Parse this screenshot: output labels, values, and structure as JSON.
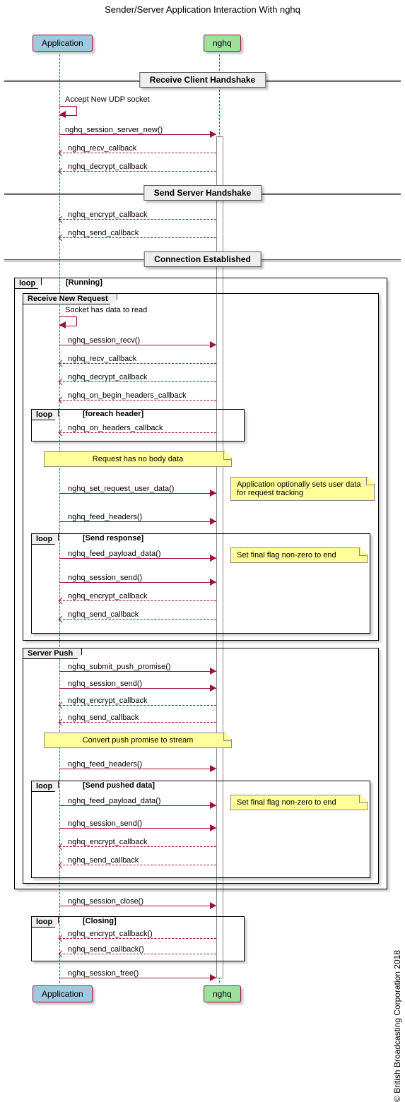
{
  "title": "Sender/Server Application Interaction With nghq",
  "actors": {
    "app": "Application",
    "nghq": "nghq"
  },
  "dividers": {
    "recv_handshake": "Receive Client Handshake",
    "send_handshake": "Send Server Handshake",
    "conn_est": "Connection Established"
  },
  "frames": {
    "running": {
      "tag": "loop",
      "cond": "[Running]"
    },
    "recv_req": {
      "title": "Receive New Request"
    },
    "foreach_header": {
      "tag": "loop",
      "cond": "[foreach header]"
    },
    "send_response": {
      "tag": "loop",
      "cond": "[Send response]"
    },
    "server_push": {
      "title": "Server Push"
    },
    "send_pushed": {
      "tag": "loop",
      "cond": "[Send pushed data]"
    },
    "closing": {
      "tag": "loop",
      "cond": "[Closing]"
    }
  },
  "messages": {
    "accept_socket": "Accept New UDP socket",
    "session_server_new": "nghq_session_server_new()",
    "recv_cb": "nghq_recv_callback",
    "decrypt_cb": "nghq_decrypt_callback",
    "encrypt_cb": "nghq_encrypt_callback",
    "send_cb": "nghq_send_callback",
    "socket_has_data": "Socket has data to read",
    "session_recv": "nghq_session_recv()",
    "on_begin_headers": "nghq_on_begin_headers_callback",
    "on_headers": "nghq_on_headers_callback",
    "set_req_user_data": "nghq_set_request_user_data()",
    "feed_headers": "nghq_feed_headers()",
    "feed_payload": "nghq_feed_payload_data()",
    "session_send": "nghq_session_send()",
    "submit_push": "nghq_submit_push_promise()",
    "session_close": "nghq_session_close()",
    "encrypt_cb_fn": "nghq_encrypt_callback()",
    "send_cb_fn": "nghq_send_callback()",
    "session_free": "nghq_session_free()"
  },
  "notes": {
    "no_body": "Request has no body data",
    "user_data": "Application optionally sets user data for request tracking",
    "final_flag": "Set final flag non-zero to end",
    "convert_push": "Convert push promise to stream"
  },
  "copyright": "© British Broadcasting Corporation 2018"
}
